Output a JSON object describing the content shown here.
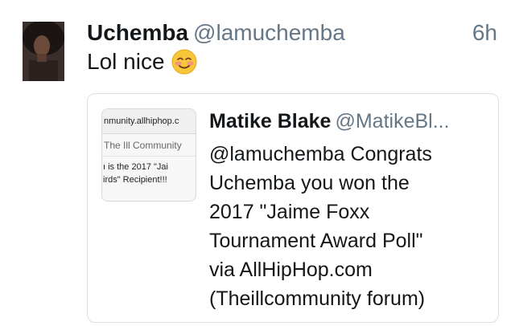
{
  "tweet": {
    "display_name": "Uchemba",
    "handle": "@lamuchemba",
    "time": "6h",
    "text": "Lol nice",
    "emoji": "blushing-smiling-face-emoji",
    "quoted": {
      "display_name": "Matike Blake",
      "handle": "@MatikeBl...",
      "text_lines": [
        "@lamuchemba  Congrats",
        "Uchemba you won the",
        "2017 \"Jaime Foxx",
        "Tournament Award Poll\"",
        "via AllHipHop.com",
        "(Theillcommunity forum)"
      ],
      "thumbnail": {
        "url_text": "nmunity.allhiphop.c",
        "line1": "The Ill Community",
        "line2": "ı is the 2017 \"Jai",
        "line3": "irds\" Recipient!!!"
      }
    }
  }
}
